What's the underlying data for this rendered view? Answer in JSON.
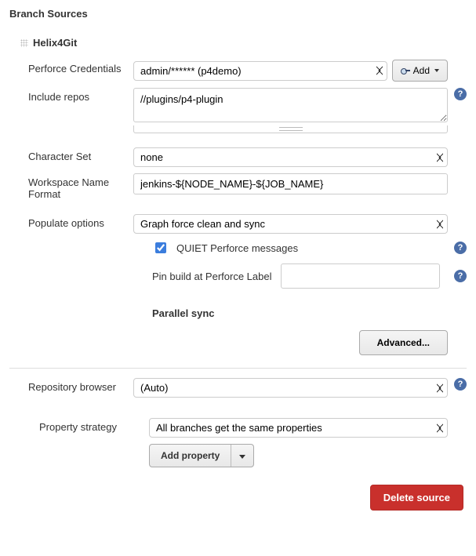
{
  "section_title": "Branch Sources",
  "source": {
    "type": "Helix4Git",
    "credentials": {
      "label": "Perforce Credentials",
      "selected": "admin/****** (p4demo)",
      "add_label": "Add"
    },
    "include_repos": {
      "label": "Include repos",
      "value": "//plugins/p4-plugin"
    },
    "charset": {
      "label": "Character Set",
      "selected": "none"
    },
    "workspace_name": {
      "label": "Workspace Name Format",
      "value": "jenkins-${NODE_NAME}-${JOB_NAME}"
    },
    "populate": {
      "label": "Populate options",
      "selected": "Graph force clean and sync",
      "quiet": {
        "checked": true,
        "label": "QUIET Perforce messages"
      },
      "pin": {
        "label": "Pin build at Perforce Label",
        "value": ""
      },
      "parallel_heading": "Parallel sync",
      "advanced_label": "Advanced..."
    },
    "repo_browser": {
      "label": "Repository browser",
      "selected": "(Auto)"
    },
    "property_strategy": {
      "label": "Property strategy",
      "selected": "All branches get the same properties",
      "add_property_label": "Add property"
    },
    "delete_label": "Delete source"
  }
}
